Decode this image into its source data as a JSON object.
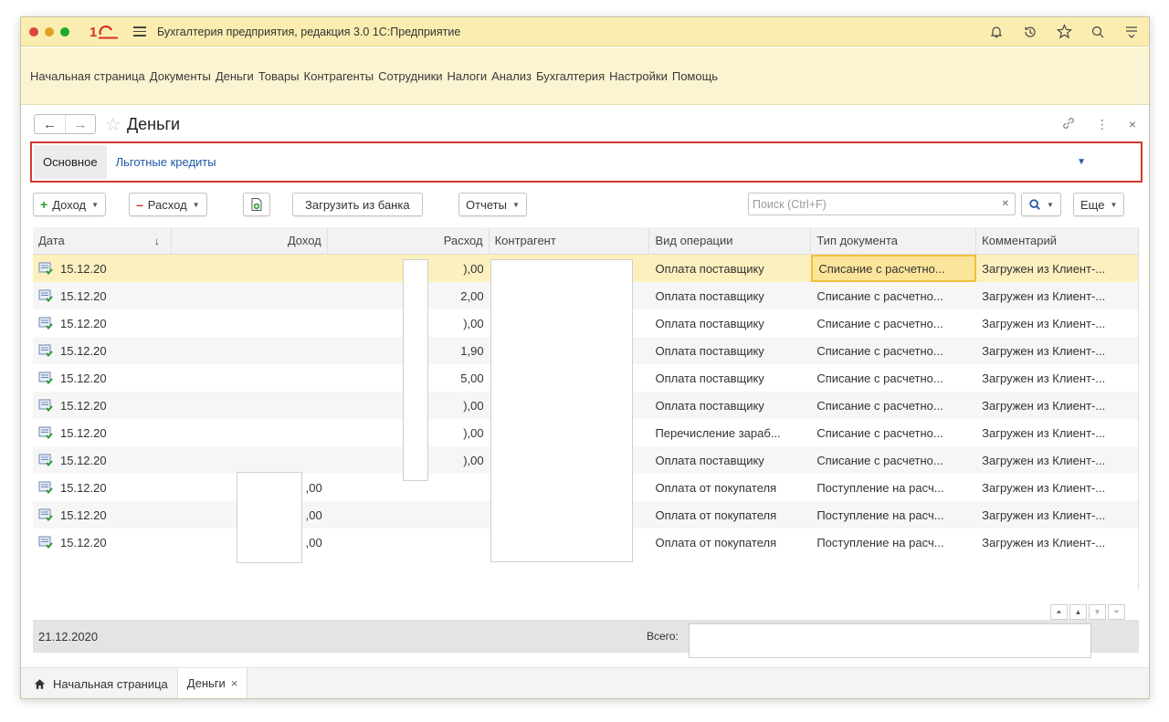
{
  "app": {
    "title": "Бухгалтерия предприятия, редакция 3.0 1С:Предприятие",
    "logo_text": "1С"
  },
  "menu": [
    "Начальная страница",
    "Документы",
    "Деньги",
    "Товары",
    "Контрагенты",
    "Сотрудники",
    "Налоги",
    "Анализ",
    "Бухгалтерия",
    "Настройки",
    "Помощь"
  ],
  "form": {
    "title": "Деньги",
    "back": "←",
    "forward": "→"
  },
  "tabs": {
    "main": "Основное",
    "link": "Льготные кредиты"
  },
  "toolbar": {
    "income": "Доход",
    "expense": "Расход",
    "load_bank": "Загрузить из банка",
    "reports": "Отчеты",
    "search_placeholder": "Поиск (Ctrl+F)",
    "more": "Еще"
  },
  "table": {
    "columns": {
      "date": "Дата",
      "sort_indicator": "↓",
      "income": "Доход",
      "expense": "Расход",
      "counterparty": "Контрагент",
      "operation": "Вид операции",
      "doc_type": "Тип документа",
      "comment": "Комментарий"
    },
    "rows": [
      {
        "date": "15.12.20",
        "income": "",
        "expense": "),00",
        "operation": "Оплата поставщику",
        "doc_type": "Списание с расчетно...",
        "comment": "Загружен из Клиент-..."
      },
      {
        "date": "15.12.20",
        "income": "",
        "expense": "2,00",
        "operation": "Оплата поставщику",
        "doc_type": "Списание с расчетно...",
        "comment": "Загружен из Клиент-..."
      },
      {
        "date": "15.12.20",
        "income": "",
        "expense": "),00",
        "operation": "Оплата поставщику",
        "doc_type": "Списание с расчетно...",
        "comment": "Загружен из Клиент-..."
      },
      {
        "date": "15.12.20",
        "income": "",
        "expense": "1,90",
        "operation": "Оплата поставщику",
        "doc_type": "Списание с расчетно...",
        "comment": "Загружен из Клиент-..."
      },
      {
        "date": "15.12.20",
        "income": "",
        "expense": "5,00",
        "operation": "Оплата поставщику",
        "doc_type": "Списание с расчетно...",
        "comment": "Загружен из Клиент-..."
      },
      {
        "date": "15.12.20",
        "income": "",
        "expense": "),00",
        "operation": "Оплата поставщику",
        "doc_type": "Списание с расчетно...",
        "comment": "Загружен из Клиент-..."
      },
      {
        "date": "15.12.20",
        "income": "",
        "expense": "),00",
        "operation": "Перечисление зараб...",
        "doc_type": "Списание с расчетно...",
        "comment": "Загружен из Клиент-..."
      },
      {
        "date": "15.12.20",
        "income": "",
        "expense": "),00",
        "operation": "Оплата поставщику",
        "doc_type": "Списание с расчетно...",
        "comment": "Загружен из Клиент-..."
      },
      {
        "date": "15.12.20",
        "income": ",00",
        "expense": "",
        "operation": "Оплата от покупателя",
        "doc_type": "Поступление на расч...",
        "comment": "Загружен из Клиент-..."
      },
      {
        "date": "15.12.20",
        "income": ",00",
        "expense": "",
        "operation": "Оплата от покупателя",
        "doc_type": "Поступление на расч...",
        "comment": "Загружен из Клиент-..."
      },
      {
        "date": "15.12.20",
        "income": ",00",
        "expense": "",
        "operation": "Оплата от покупателя",
        "doc_type": "Поступление на расч...",
        "comment": "Загружен из Клиент-..."
      }
    ]
  },
  "footer": {
    "date": "21.12.2020",
    "total_label": "Всего:"
  },
  "bottom_tabs": {
    "home": "Начальная страница",
    "current": "Деньги",
    "close": "×"
  },
  "colors": {
    "titlebar": "#fbedb0",
    "menubar": "#fbf4d2",
    "highlight_border": "#d33a2c",
    "link": "#1e5aa8",
    "selected_row": "#fcf0be"
  }
}
